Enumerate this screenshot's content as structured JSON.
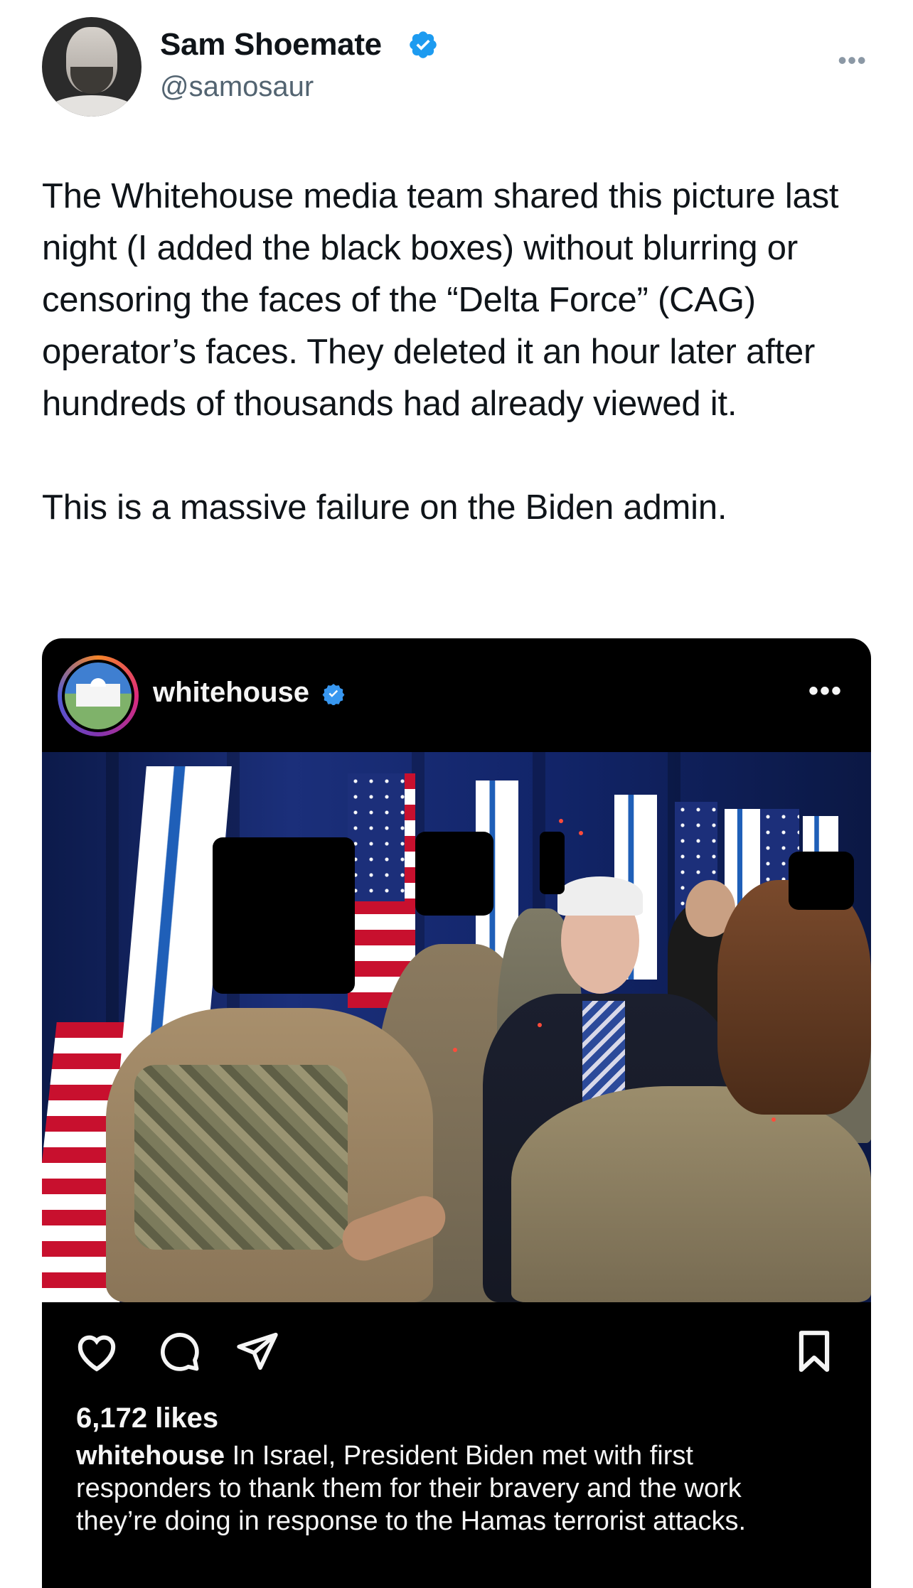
{
  "tweet": {
    "author_name": "Sam Shoemate",
    "handle": "@samosaur",
    "more_icon": "more-horizontal-icon",
    "paragraphs": [
      "The Whitehouse media team shared this picture last night (I added the black boxes) without blurring or censoring the faces of the “Delta Force” (CAG) operator’s faces. They deleted it an hour later after hundreds of thousands had already viewed it.",
      "This is a massive failure on the Biden admin."
    ],
    "accent_color": "#1d9bf0"
  },
  "instagram_post": {
    "username": "whitehouse",
    "likes_text": "6,172 likes",
    "caption_user": "whitehouse",
    "caption_text": " In Israel, President Biden met with first responders to thank them for their bravery and the work they’re doing in response to the Hamas terrorist attacks.",
    "icons": [
      "heart-icon",
      "comment-icon",
      "share-icon",
      "bookmark-icon"
    ],
    "verified_color": "#3897f0"
  }
}
